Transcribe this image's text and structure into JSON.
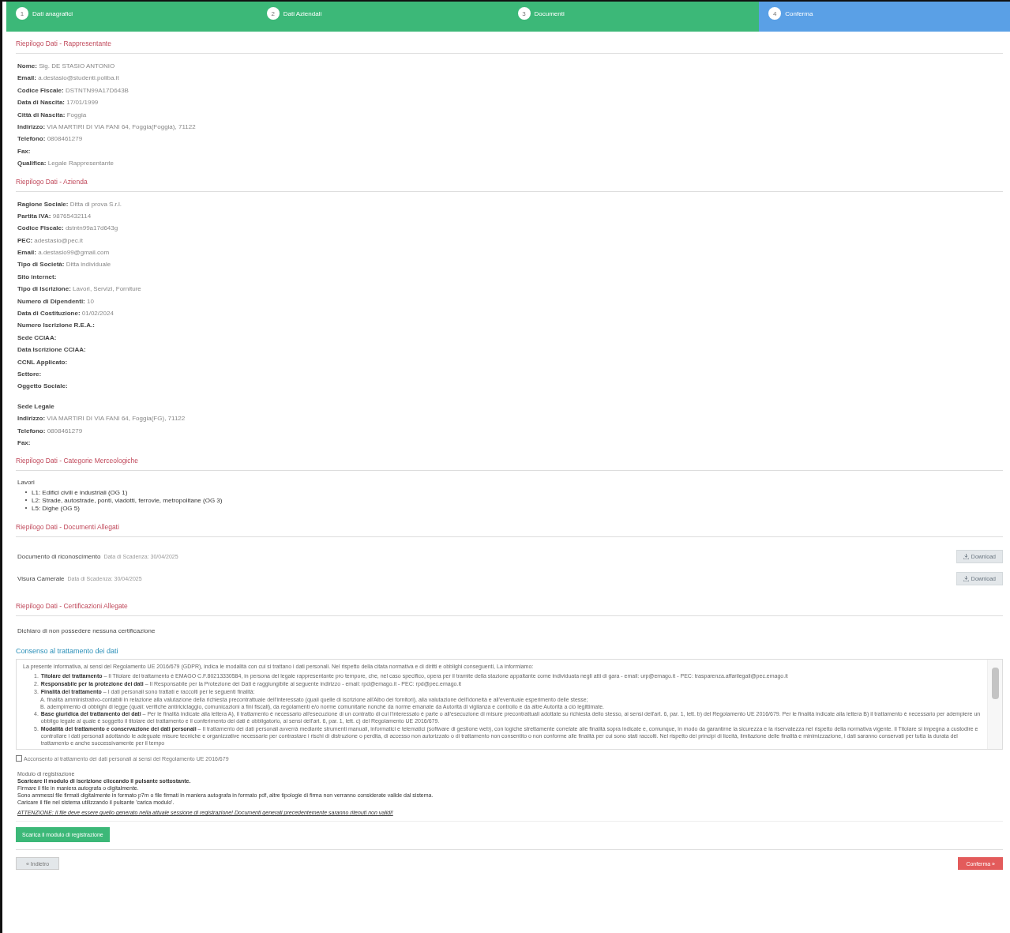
{
  "steps": [
    {
      "number": "1",
      "label": "Dati anagrafici",
      "selected": false
    },
    {
      "number": "2",
      "label": "Dati Aziendali",
      "selected": false
    },
    {
      "number": "3",
      "label": "Documenti",
      "selected": false
    },
    {
      "number": "4",
      "label": "Conferma",
      "selected": true
    }
  ],
  "representative": {
    "title": "Riepilogo Dati - Rappresentante",
    "fields": [
      {
        "label": "Nome:",
        "value": "Sig. DE STASIO ANTONIO"
      },
      {
        "label": "Email:",
        "value": "a.destasio@studenti.poliba.it"
      },
      {
        "label": "Codice Fiscale:",
        "value": "DSTNTN99A17D643B"
      },
      {
        "label": "Data di Nascita:",
        "value": "17/01/1999"
      },
      {
        "label": "Città di Nascita:",
        "value": "Foggia"
      },
      {
        "label": "Indirizzo:",
        "value": "VIA MARTIRI DI VIA FANI 64, Foggia(Foggia), 71122"
      },
      {
        "label": "Telefono:",
        "value": "0808461279"
      },
      {
        "label": "Fax:"
      },
      {
        "label": "Qualifica:",
        "value": "Legale Rappresentante"
      }
    ]
  },
  "company": {
    "title": "Riepilogo Dati - Azienda",
    "fields": [
      {
        "label": "Ragione Sociale:",
        "value": "Ditta di prova S.r.l."
      },
      {
        "label": "Partita IVA:",
        "value": "98765432114"
      },
      {
        "label": "Codice Fiscale:",
        "value": "dstntn99a17d643g"
      },
      {
        "label": "PEC:",
        "value": "adestasio@pec.it"
      },
      {
        "label": "Email:",
        "value": "a.destasio99@gmail.com"
      },
      {
        "label": "Tipo di Società:",
        "value": "Ditta individuale"
      },
      {
        "label": "Sito internet:"
      },
      {
        "label": "Tipo di Iscrizione:",
        "value": "Lavori, Servizi, Forniture"
      },
      {
        "label": "Numero di Dipendenti:",
        "value": "10"
      },
      {
        "label": "Data di Costituzione:",
        "value": "01/02/2024"
      },
      {
        "label": "Numero Iscrizione R.E.A.:"
      },
      {
        "label": "Sede CCIAA:"
      },
      {
        "label": "Data Iscrizione CCIAA:"
      },
      {
        "label": "CCNL Applicato:"
      },
      {
        "label": "Settore:"
      },
      {
        "label": "Oggetto Sociale:"
      }
    ],
    "seat_title": "Sede Legale",
    "seat_fields": [
      {
        "label": "Indirizzo:",
        "value": "VIA MARTIRI DI VIA FANI 64, Foggia(FG), 71122"
      },
      {
        "label": "Telefono:",
        "value": "0808461279"
      },
      {
        "label": "Fax:"
      }
    ]
  },
  "categories": {
    "title": "Riepilogo Dati - Categorie Merceologiche",
    "group": "Lavori",
    "items": [
      "L1: Edifici civili e industriali (OG 1)",
      "L2: Strade, autostrade, ponti, viadotti, ferrovie, metropolitane (OG 3)",
      "L5: Dighe (OG 5)"
    ]
  },
  "documents": {
    "title": "Riepilogo Dati - Documenti Allegati",
    "items": [
      {
        "name": "Documento di riconoscimento",
        "expiry": "Data di Scadenza: 30/04/2025",
        "button": "Download"
      },
      {
        "name": "Visura Camerale",
        "expiry": "Data di Scadenza: 30/04/2025",
        "button": "Download"
      }
    ]
  },
  "certifications": {
    "title": "Riepilogo Dati - Certificazioni Allegate",
    "text": "Dichiaro di non possedere nessuna certificazione"
  },
  "consent": {
    "title": "Consenso al trattamento dei dati",
    "intro": "La presente informativa, ai sensi del Regolamento UE 2016/679 (GDPR), indica le modalità con cui si trattano i dati personali. Nel rispetto della citata normativa e di diritti e obblighi conseguenti, La informiamo:",
    "items": [
      {
        "number": "1.",
        "title": "Titolare del trattamento",
        "text": "– Il Titolare del trattamento è EMAGO C.F.80213330584, in persona del legale rappresentante pro tempore, che, nel caso specifico, opera per il tramite della stazione appaltante come individuata negli atti di gara - email: urp@emago.it - PEC: trasparenza.affarilegali@pec.emago.it"
      },
      {
        "number": "2.",
        "title": "Responsabile per la protezione dei dati",
        "text": "– Il Responsabile per la Protezione dei Dati è raggiungibile al seguente indirizzo - email: rpd@emago.it - PEC: rpd@pec.emago.it"
      },
      {
        "number": "3.",
        "title": "Finalità del trattamento",
        "text": "– I dati personali sono trattati e raccolti per le seguenti finalità:",
        "subitems": [
          "A. finalità amministrativo-contabili in relazione alla valutazione della richiesta precontrattuale dell'interessato (quali quelle di iscrizione all'Albo dei fornitori), alla valutazione dell'idoneità e all'eventuale esperimento delle stesse;",
          "B. adempimento di obblighi di legge (quali: verifiche antiriciclaggio, comunicazioni a fini fiscali), da regolamenti e/o norme comunitarie nonché da norme emanate da Autorità di vigilanza e controllo e da altre Autorità a ciò legittimate."
        ]
      },
      {
        "number": "4.",
        "title": "Base giuridica del trattamento dei dati",
        "text": "– Per le finalità indicate alla lettera A), il trattamento è necessario all'esecuzione di un contratto di cui l'interessato è parte o all'esecuzione di misure precontrattuali adottate su richiesta dello stesso, ai sensi dell'art. 6, par. 1, lett. b) del Regolamento UE 2016/679. Per le finalità indicate alla lettera B) il trattamento è necessario per adempiere un obbligo legale al quale è soggetto il titolare del trattamento e il conferimento dei dati è obbligatorio, ai sensi dell'art. 6, par. 1, lett. c) del Regolamento UE 2016/679."
      },
      {
        "number": "5.",
        "title": "Modalità del trattamento e conservazione dei dati personali",
        "text": "– Il trattamento dei dati personali avverrà mediante strumenti manuali, informatici e telematici (software di gestione web), con logiche strettamente correlate alle finalità sopra indicate e, comunque, in modo da garantirne la sicurezza e la riservatezza nel rispetto della normativa vigente. Il Titolare si impegna a custodire e controllare i dati personali adottando le adeguate misure tecniche e organizzative necessarie per contrastare i rischi di distruzione o perdita, di accesso non autorizzato o di trattamento non consentito o non conforme alle finalità per cui sono stati raccolti. Nel rispetto dei principi di liceità, limitazione delle finalità e minimizzazione, i dati saranno conservati per tutta la durata del trattamento e anche successivamente per il tempo"
      }
    ],
    "checkbox": {
      "label": "Acconsento al trattamento dei dati personali ai sensi del Regolamento UE 2016/679",
      "checked": false
    }
  },
  "registration": {
    "caption": "Modulo di registrazione",
    "instructions": [
      {
        "kind": "bold",
        "text": "Scaricare il modulo di iscrizione cliccando il pulsante sottostante."
      },
      {
        "kind": "plain",
        "text": "Firmare il file in maniera autografa o digitalmente."
      },
      {
        "kind": "plain",
        "text": "Sono ammessi file firmati digitalmente in formato p7m o file firmati in maniera autografa in formato pdf, altre tipologie di firma non verranno considerate valide dal sistema."
      },
      {
        "kind": "plain",
        "text": "Caricare il file nel sistema utilizzando il pulsante 'carica modulo'."
      }
    ],
    "warning": "ATTENZIONE: Il file deve essere quello generato nella attuale sessione di registrazione! Documenti generati precedentemente saranno ritenuti non validi!",
    "button": "Scarica il modulo di registrazione"
  },
  "footer": {
    "back_button": "« Indietro",
    "confirm_button": "Conferma »"
  }
}
